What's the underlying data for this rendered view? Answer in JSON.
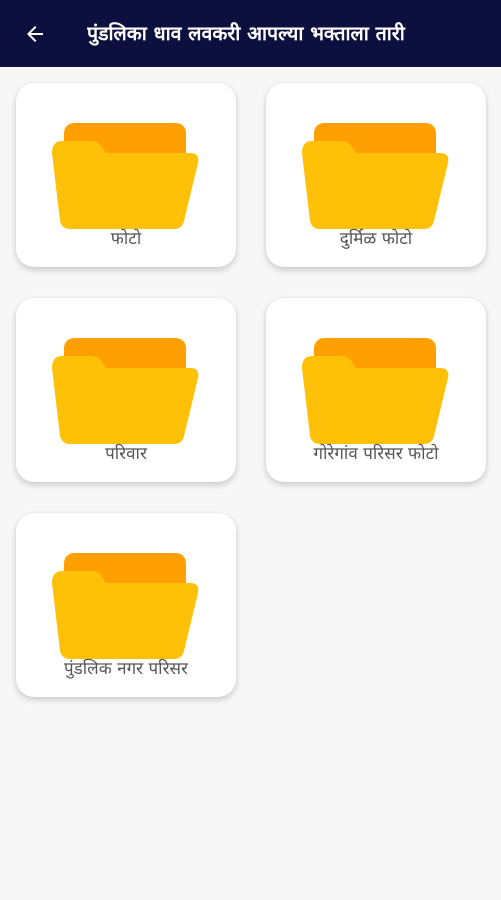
{
  "app_bar": {
    "title": "पुंडलिका धाव लवकरी आपल्या भक्ताला तारी",
    "back_icon": "arrow-left-icon",
    "background": "#0d0f3f"
  },
  "folders": [
    {
      "label": "फोटो",
      "icon": "folder-icon"
    },
    {
      "label": "दुर्मिळ फोटो",
      "icon": "folder-icon"
    },
    {
      "label": "परिवार",
      "icon": "folder-icon"
    },
    {
      "label": "गोरेगांव परिसर फोटो",
      "icon": "folder-icon"
    },
    {
      "label": "पुंडलिक नगर परिसर",
      "icon": "folder-icon"
    }
  ],
  "colors": {
    "folder_back": "#ffa000",
    "folder_front": "#ffc107",
    "page_background": "#f7f7f7"
  }
}
